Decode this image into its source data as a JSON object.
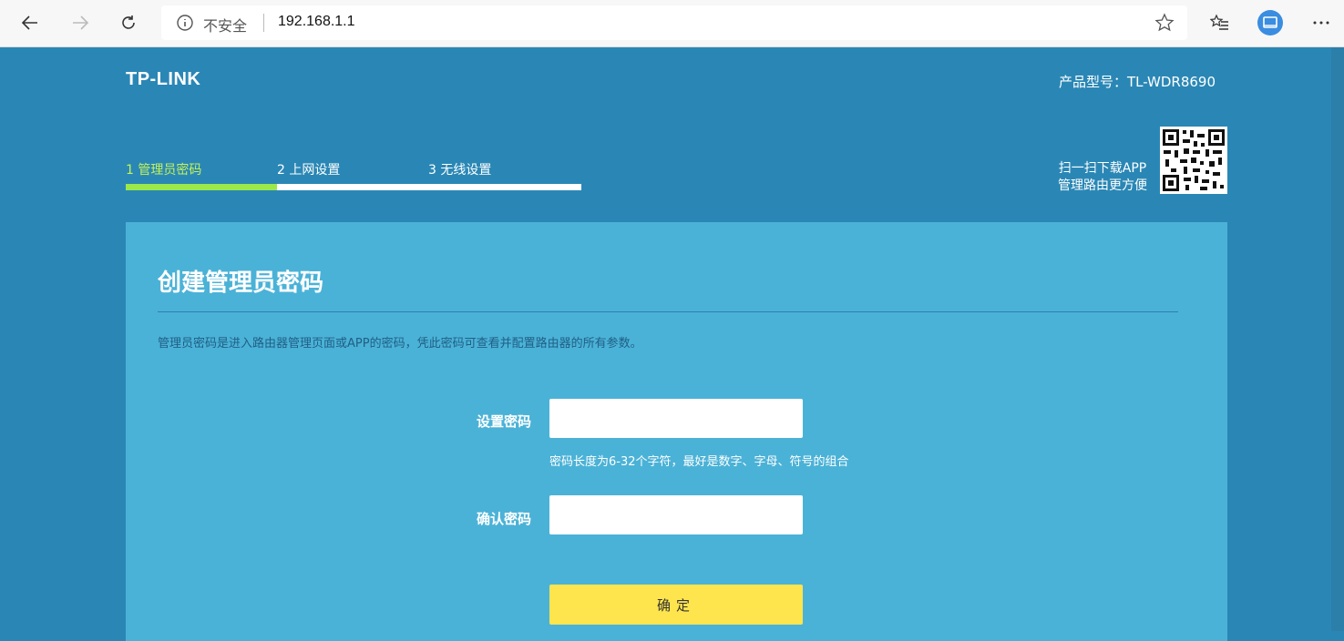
{
  "browser": {
    "security_label": "不安全",
    "url": "192.168.1.1"
  },
  "header": {
    "logo": "TP-LINK",
    "model": "产品型号：TL-WDR8690"
  },
  "steps": [
    {
      "label": "1 管理员密码",
      "active": true
    },
    {
      "label": "2 上网设置",
      "active": false
    },
    {
      "label": "3 无线设置",
      "active": false
    }
  ],
  "app_tip": {
    "line1": "扫一扫下载APP",
    "line2": "管理路由更方便"
  },
  "form": {
    "title": "创建管理员密码",
    "description": "管理员密码是进入路由器管理页面或APP的密码，凭此密码可查看并配置路由器的所有参数。",
    "password_label": "设置密码",
    "password_hint": "密码长度为6-32个字符，最好是数字、字母、符号的组合",
    "confirm_label": "确认密码",
    "submit_label": "确定"
  },
  "colors": {
    "page_bg": "#2a87b5",
    "card_bg": "#4bb2d7",
    "active_step": "#9be84a",
    "button": "#ffe54d"
  }
}
